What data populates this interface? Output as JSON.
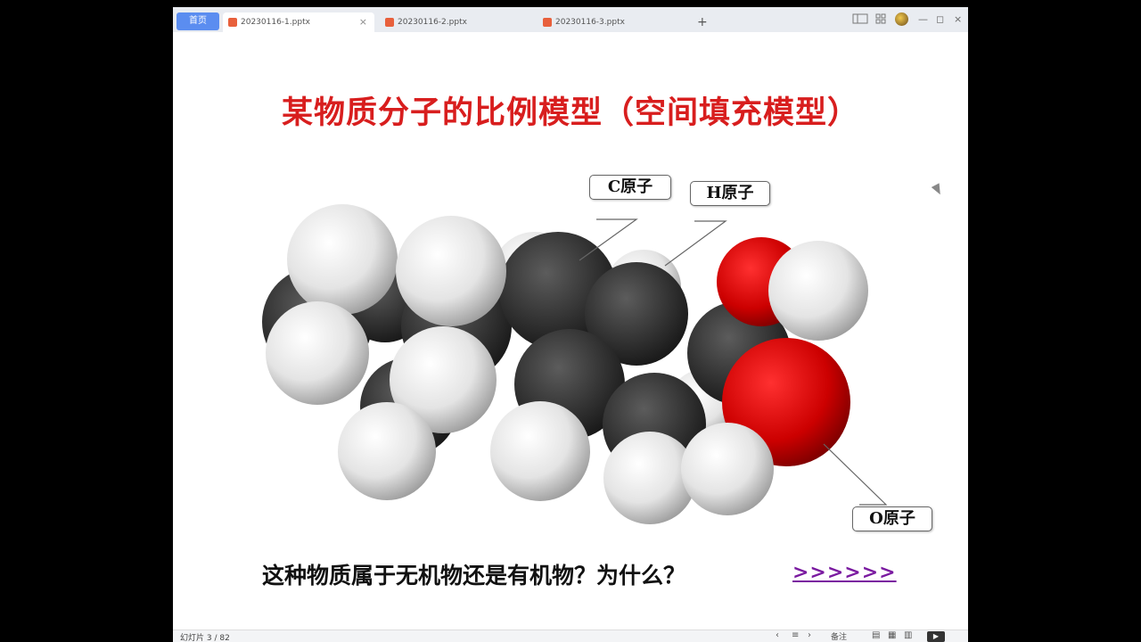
{
  "tabs": {
    "home_label": "首页",
    "items": [
      {
        "label": "20230116-1.pptx"
      },
      {
        "label": "20230116-2.pptx"
      },
      {
        "label": "20230116-3.pptx"
      }
    ],
    "close_symbol": "×",
    "add_symbol": "+"
  },
  "window_controls": {
    "minimize": "—",
    "maximize": "◻",
    "close": "×"
  },
  "slide": {
    "title": "某物质分子的比例模型（空间填充模型）",
    "callouts": {
      "c_atom": "C原子",
      "h_atom": "H原子",
      "o_atom": "O原子"
    },
    "question": "这种物质属于无机物还是有机物？为什么？",
    "next_link": ">>>>>>",
    "colors": {
      "title": "#d81e1e",
      "link": "#7a1aa0",
      "carbon": "#2e2e2e",
      "hydrogen": "#f2f2f2",
      "oxygen": "#d40000"
    }
  },
  "statusbar": {
    "slide_info": "幻灯片 3 / 82",
    "notes_label": "备注"
  }
}
